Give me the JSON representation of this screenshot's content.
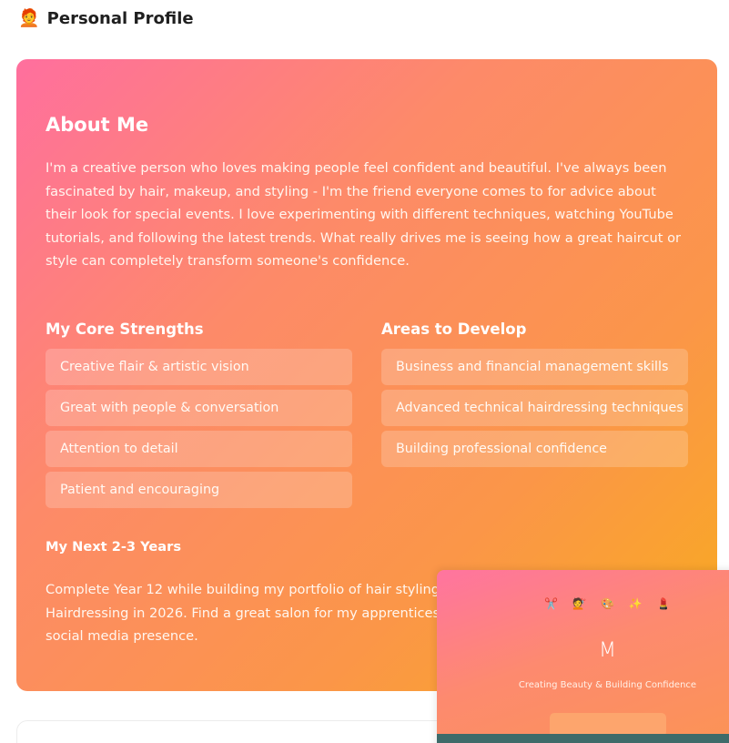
{
  "header": {
    "emoji": "🧑‍🦰",
    "title": "Personal Profile"
  },
  "about": {
    "title": "About Me",
    "text": "I'm a creative person who loves making people feel confident and beautiful. I've always been fascinated by hair, makeup, and styling - I'm the friend everyone comes to for advice about their look for special events. I love experimenting with different techniques, watching YouTube tutorials, and following the latest trends. What really drives me is seeing how a great haircut or style can completely transform someone's confidence.",
    "strengths": {
      "title": "My Core Strengths",
      "items": [
        {
          "label": "Creative flair & artistic vision"
        },
        {
          "label": "Great with people & conversation"
        },
        {
          "label": "Attention to detail"
        },
        {
          "label": "Patient and encouraging"
        }
      ]
    },
    "develop": {
      "title": "Areas to Develop",
      "items": [
        {
          "label": "Business and financial management skills"
        },
        {
          "label": "Advanced technical hairdressing techniques"
        },
        {
          "label": "Building professional confidence"
        }
      ]
    },
    "next": {
      "title": "My Next 2-3 Years",
      "text": "Complete Year 12 while building my portfolio of hair styling work. Start my Certificate III in Hairdressing in 2026. Find a great salon for my apprenticeship and keep growing my skills and social media presence."
    }
  },
  "preview": {
    "icons": [
      "✂️",
      "💇",
      "🎨",
      "✨",
      "💄"
    ],
    "initial": "M",
    "tagline": "Creating Beauty & Building Confidence"
  },
  "colors": {
    "gradient_start": "#ff6f9e",
    "gradient_end": "#f8ac1d",
    "preview_strip": "#3e6b6a"
  }
}
